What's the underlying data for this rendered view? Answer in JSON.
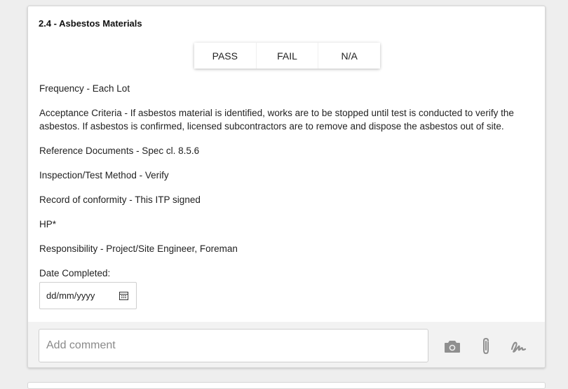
{
  "section": {
    "title": "2.4 - Asbestos Materials"
  },
  "result_buttons": {
    "pass": "PASS",
    "fail": "FAIL",
    "na": "N/A"
  },
  "fields": {
    "frequency": "Frequency - Each Lot",
    "acceptance_line1": "Acceptance Criteria - If asbestos material is identified, works are to be stopped until test is conducted to verify the",
    "acceptance_line2": "asbestos. If asbestos is confirmed, licensed subcontractors are to remove and dispose the asbestos out of site.",
    "reference": "Reference Documents - Spec cl. 8.5.6",
    "method": "Inspection/Test Method - Verify",
    "record": "Record of conformity - This ITP signed",
    "hold_point": "HP*",
    "responsibility": "Responsibility - Project/Site Engineer, Foreman",
    "date_label": "Date Completed:"
  },
  "date_input": {
    "placeholder": "dd/mm/yyyy",
    "icon": "calendar-icon"
  },
  "footer": {
    "comment_placeholder": "Add comment",
    "icons": [
      "camera-icon",
      "paperclip-icon",
      "signature-icon"
    ],
    "icon_color": "#8f8f8f"
  }
}
